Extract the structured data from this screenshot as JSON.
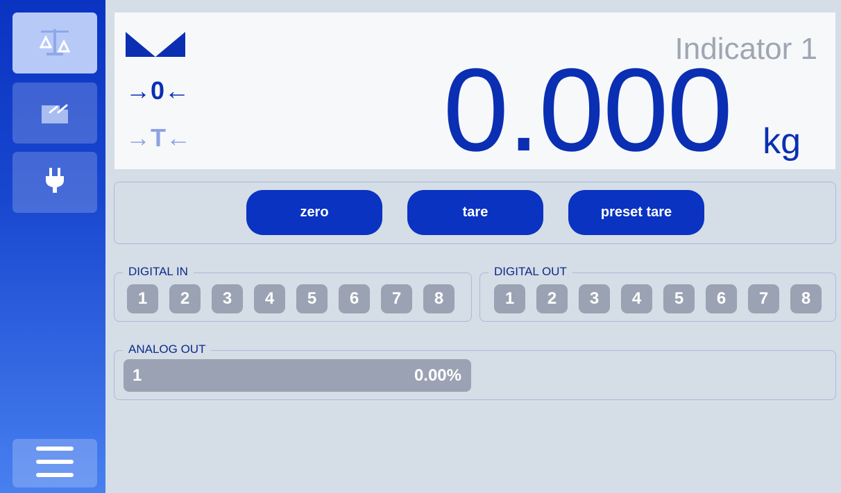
{
  "sidebar": {
    "items": [
      {
        "icon": "scale-icon",
        "active": true
      },
      {
        "icon": "factory-icon",
        "active": false
      },
      {
        "icon": "plug-icon",
        "active": false
      }
    ],
    "menu_icon": "hamburger-menu-icon"
  },
  "display": {
    "title": "Indicator 1",
    "weight": "0.000",
    "unit": "kg",
    "zero_indicator": "→0←",
    "tare_indicator": "→T←",
    "stable_icon": "stability-icon"
  },
  "actions": {
    "zero_label": "zero",
    "tare_label": "tare",
    "preset_tare_label": "preset tare"
  },
  "digital_in": {
    "label": "DIGITAL IN",
    "channels": [
      "1",
      "2",
      "3",
      "4",
      "5",
      "6",
      "7",
      "8"
    ]
  },
  "digital_out": {
    "label": "DIGITAL OUT",
    "channels": [
      "1",
      "2",
      "3",
      "4",
      "5",
      "6",
      "7",
      "8"
    ]
  },
  "analog_out": {
    "label": "ANALOG OUT",
    "channel": "1",
    "value": "0.00%"
  },
  "colors": {
    "accent": "#0a33c2",
    "weight_text": "#0a2fb3",
    "background": "#d5dde6",
    "io_inactive": "#9aa2b3"
  }
}
